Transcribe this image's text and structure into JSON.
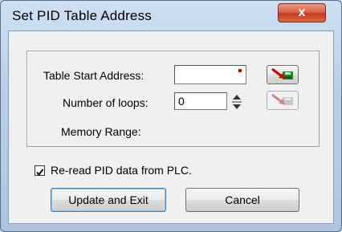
{
  "window": {
    "title": "Set PID Table Address",
    "close_glyph": "x"
  },
  "form": {
    "table_start_label": "Table Start Address:",
    "table_start_value": "",
    "loops_label": "Number of loops:",
    "loops_value": "0",
    "memory_range_label": "Memory Range:"
  },
  "options": {
    "reread_label": "Re-read PID data from PLC.",
    "reread_checked": true
  },
  "buttons": {
    "update_label": "Update and Exit",
    "cancel_label": "Cancel"
  },
  "icons": {
    "read_address": "arrow-to-plc-icon",
    "write_disabled": "arrow-from-plc-icon"
  },
  "colors": {
    "required_marker": "#c00000",
    "close_button": "#c33c20"
  }
}
